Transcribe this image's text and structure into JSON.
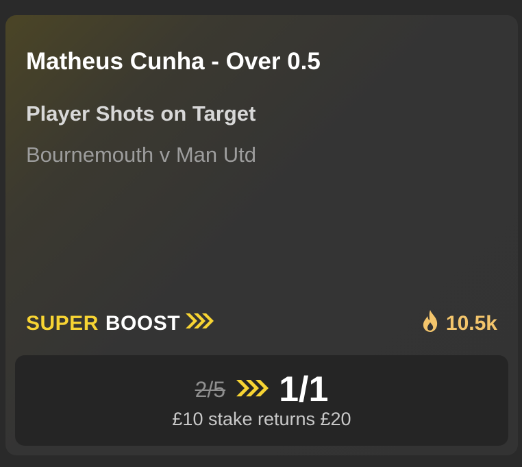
{
  "selection": {
    "title": "Matheus Cunha - Over 0.5",
    "market": "Player Shots on Target",
    "event": "Bournemouth v Man Utd"
  },
  "boost": {
    "super_label": "SUPER",
    "boost_label": "BOOST",
    "icon": "triple-chevron-right-icon"
  },
  "popularity": {
    "icon": "flame-icon",
    "count": "10.5k"
  },
  "odds": {
    "old": "2/5",
    "new": "1/1",
    "returns_text": "£10 stake returns £20"
  },
  "colors": {
    "accent_yellow": "#f7d433",
    "popularity_orange": "#f3c56c",
    "card_bg": "#333333",
    "odds_box_bg": "#252525"
  }
}
